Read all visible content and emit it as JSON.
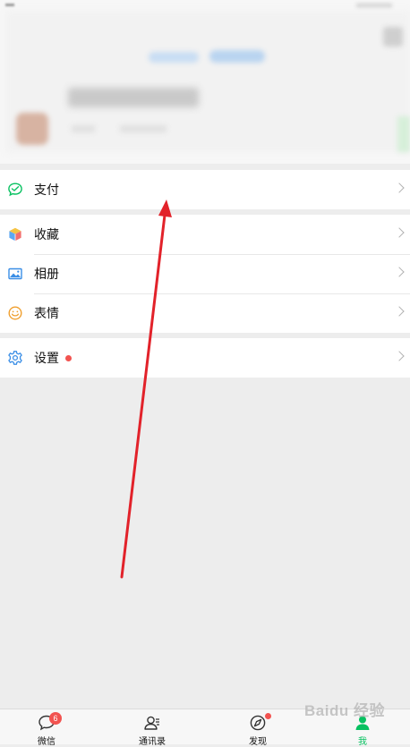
{
  "menu": {
    "group1": [
      {
        "label": "支付",
        "icon": "wallet-icon"
      }
    ],
    "group2": [
      {
        "label": "收藏",
        "icon": "cube-icon"
      },
      {
        "label": "相册",
        "icon": "photo-album-icon"
      },
      {
        "label": "表情",
        "icon": "smiley-icon"
      }
    ],
    "group3": [
      {
        "label": "设置",
        "icon": "gear-icon",
        "has_red_dot": true
      }
    ]
  },
  "tab_bar": {
    "tabs": [
      {
        "label": "微信",
        "icon": "chat-bubble-icon",
        "badge": "6"
      },
      {
        "label": "通讯录",
        "icon": "contacts-icon"
      },
      {
        "label": "发现",
        "icon": "compass-icon",
        "has_red_dot": true
      },
      {
        "label": "我",
        "icon": "person-icon",
        "active": true
      }
    ]
  },
  "colors": {
    "accent_green": "#07c160",
    "badge_red": "#f25350",
    "annotation_arrow": "#e2222a",
    "background": "#ededed"
  },
  "watermark": "Baidu 经验"
}
